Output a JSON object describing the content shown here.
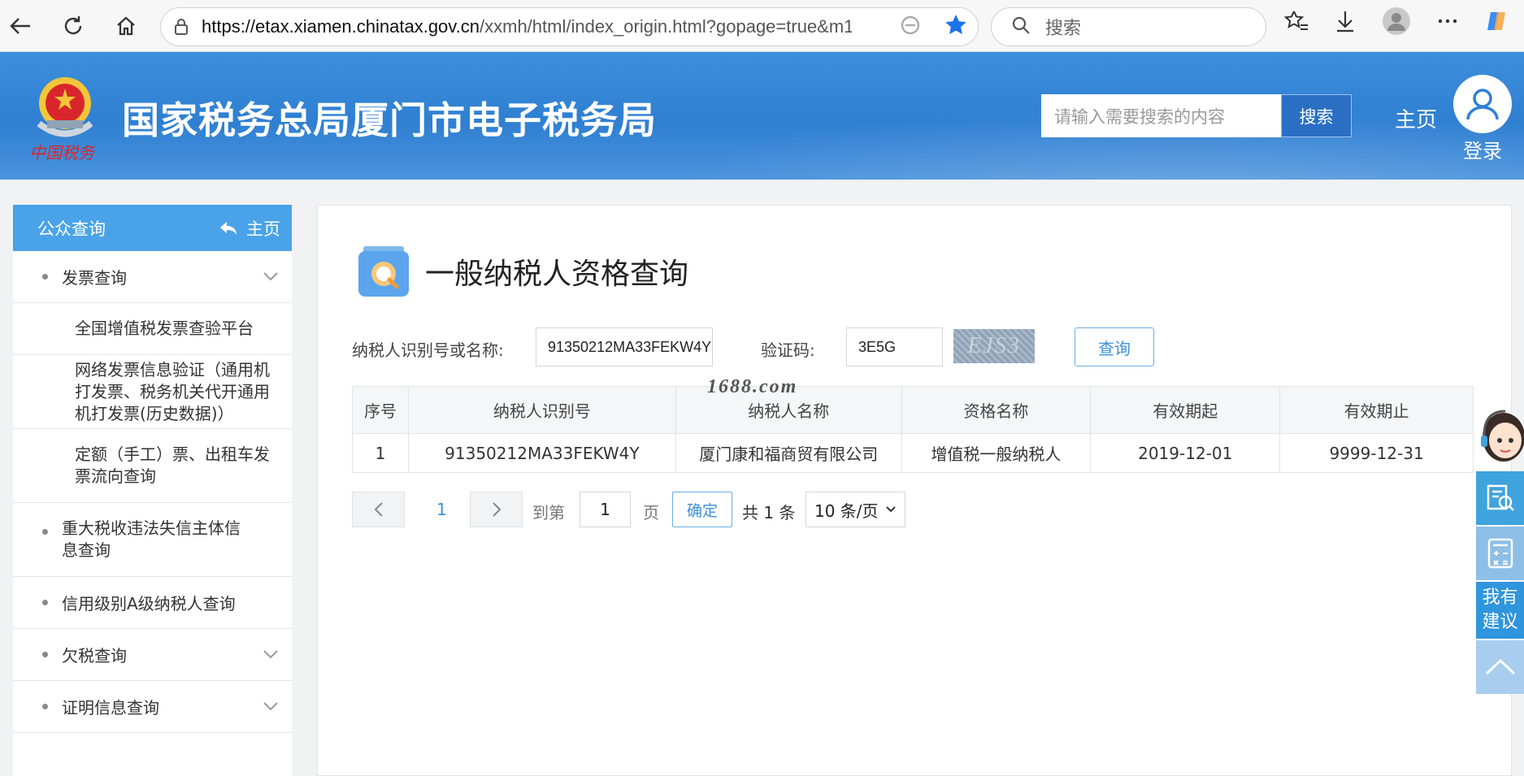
{
  "browser": {
    "url_host": "https://etax.xiamen.chinatax.gov.cn",
    "url_path": "/xxmh/html/index_origin.html?gopage=true&m1...",
    "search_placeholder": "搜索"
  },
  "header": {
    "emblem_signature": "中国税务",
    "title": "国家税务总局厦门市电子税务局",
    "search_placeholder": "请输入需要搜索的内容",
    "search_button": "搜索",
    "home": "主页",
    "login": "登录"
  },
  "sidebar": {
    "title": "公众查询",
    "home": "主页",
    "items": [
      {
        "label": "发票查询",
        "level": 1,
        "expandable": true
      },
      {
        "label": "全国增值税发票查验平台",
        "level": 2
      },
      {
        "label": "网络发票信息验证（通用机打发票、税务机关代开通用机打发票(历史数据)）",
        "level": 2
      },
      {
        "label": "定额（手工）票、出租车发票流向查询",
        "level": 2
      },
      {
        "label": "重大税收违法失信主体信息查询",
        "level": 1,
        "expandable": false
      },
      {
        "label": "信用级别A级纳税人查询",
        "level": 1,
        "expandable": false
      },
      {
        "label": "欠税查询",
        "level": 1,
        "expandable": true
      },
      {
        "label": "证明信息查询",
        "level": 1,
        "expandable": true
      }
    ]
  },
  "main": {
    "title": "一般纳税人资格查询",
    "form": {
      "taxpayer_label": "纳税人识别号或名称:",
      "taxpayer_value": "91350212MA33FEKW4Y",
      "captcha_label": "验证码:",
      "captcha_value": "3E5G",
      "captcha_image_text": "EJS3",
      "query_button": "查询"
    },
    "table": {
      "headers": [
        "序号",
        "纳税人识别号",
        "纳税人名称",
        "资格名称",
        "有效期起",
        "有效期止"
      ],
      "rows": [
        [
          "1",
          "91350212MA33FEKW4Y",
          "厦门康和福商贸有限公司",
          "增值税一般纳税人",
          "2019-12-01",
          "9999-12-31"
        ]
      ]
    },
    "pager": {
      "current_page": "1",
      "goto_label": "到第",
      "goto_value": "1",
      "page_unit": "页",
      "confirm": "确定",
      "total": "共 1 条",
      "page_size": "10 条/页"
    }
  },
  "watermark": "1688.com",
  "float_tools": {
    "suggest": [
      "我有",
      "建议"
    ]
  },
  "colors": {
    "header_blue": "#2f7fd2",
    "sidebar_head": "#4aa3e8",
    "accent": "#3d90d8"
  }
}
